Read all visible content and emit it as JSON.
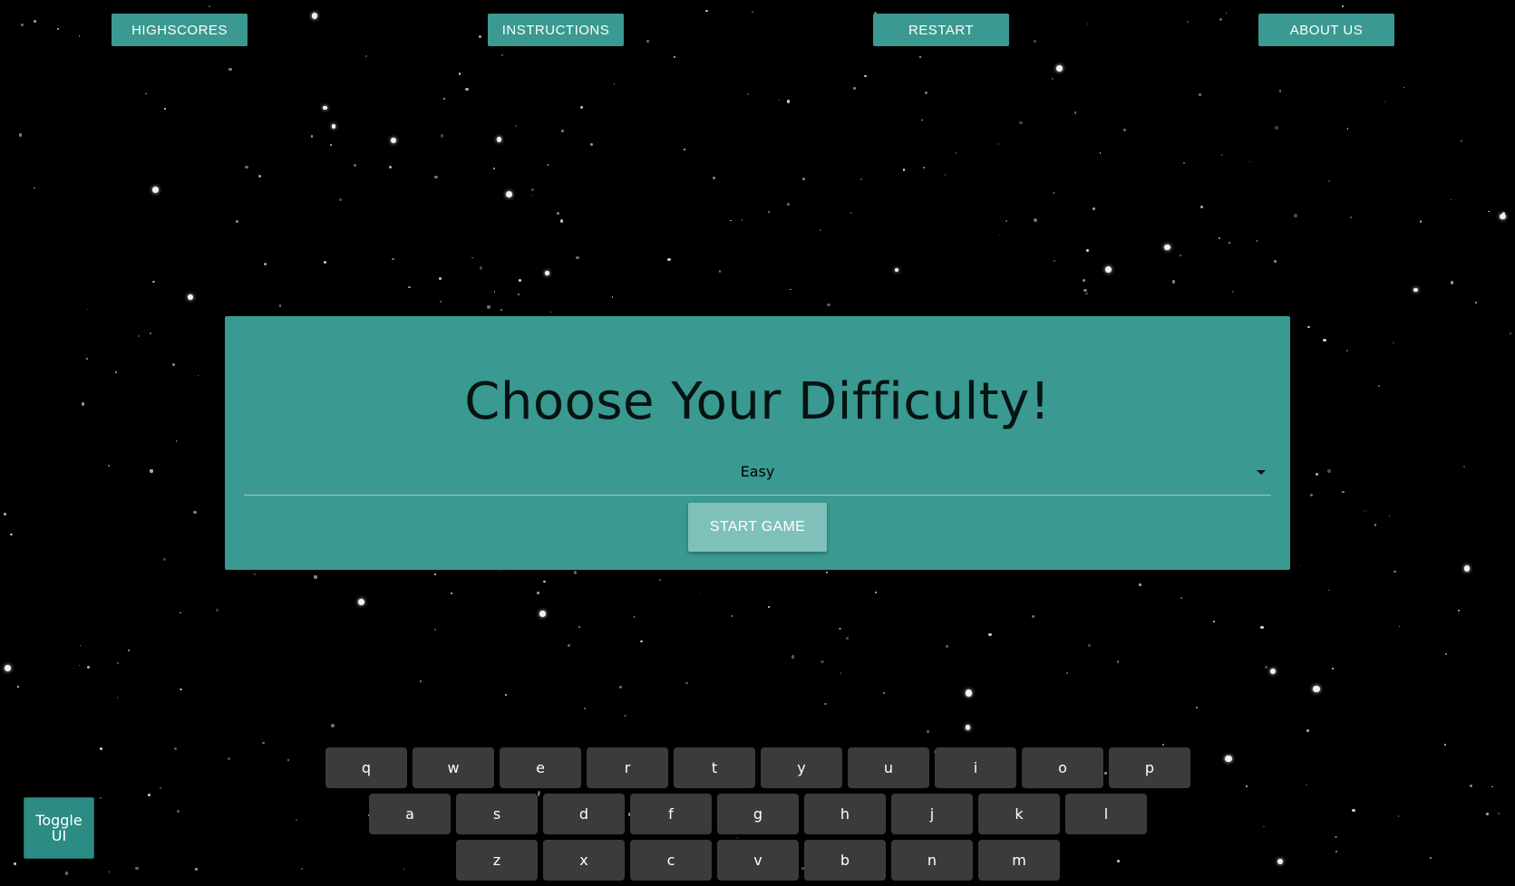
{
  "nav": {
    "highscores": "HIGHSCORES",
    "instructions": "INSTRUCTIONS",
    "restart": "RESTART",
    "about": "ABOUT US"
  },
  "panel": {
    "title": "Choose Your Difficulty!",
    "difficulty_selected": "Easy",
    "start_button": "START GAME"
  },
  "keyboard": {
    "row1": [
      "q",
      "w",
      "e",
      "r",
      "t",
      "y",
      "u",
      "i",
      "o",
      "p"
    ],
    "row2": [
      "a",
      "s",
      "d",
      "f",
      "g",
      "h",
      "j",
      "k",
      "l"
    ],
    "row3": [
      "z",
      "x",
      "c",
      "v",
      "b",
      "n",
      "m"
    ]
  },
  "toggle_ui": "Toggle UI",
  "colors": {
    "accent": "#3a9990",
    "start_button": "#7fc1ba",
    "key": "#3b3b3b",
    "background": "#000000"
  }
}
